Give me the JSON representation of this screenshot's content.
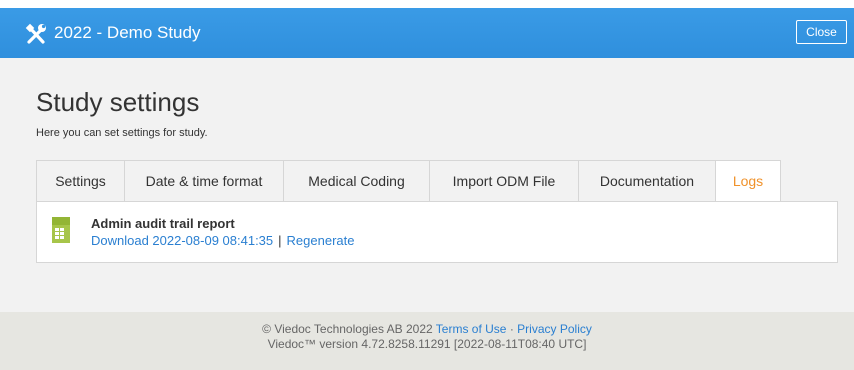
{
  "header": {
    "title": "2022 - Demo Study",
    "tools_icon": "tools-icon",
    "close_label": "Close"
  },
  "page": {
    "title": "Study settings",
    "description": "Here you can set settings for study."
  },
  "tabs": [
    {
      "label": "Settings",
      "active": false
    },
    {
      "label": "Date & time format",
      "active": false
    },
    {
      "label": "Medical Coding",
      "active": false
    },
    {
      "label": "Import ODM File",
      "active": false
    },
    {
      "label": "Documentation",
      "active": false
    },
    {
      "label": "Logs",
      "active": true
    }
  ],
  "report": {
    "icon": "excel-file-icon",
    "title": "Admin audit trail report",
    "download_label": "Download 2022-08-09 08:41:35",
    "separator": "|",
    "regenerate_label": "Regenerate"
  },
  "footer": {
    "copyright": "© Viedoc Technologies AB 2022",
    "terms_label": "Terms of Use",
    "dot": "·",
    "privacy_label": "Privacy Policy",
    "version": "Viedoc™ version 4.72.8258.11291 [2022-08-11T08:40 UTC]"
  },
  "colors": {
    "header_bg": "#3496e2",
    "link": "#2a7fd1",
    "active_tab": "#f0922b",
    "content_bg": "#f2f2f2",
    "footer_bg": "#e6e6e1"
  }
}
